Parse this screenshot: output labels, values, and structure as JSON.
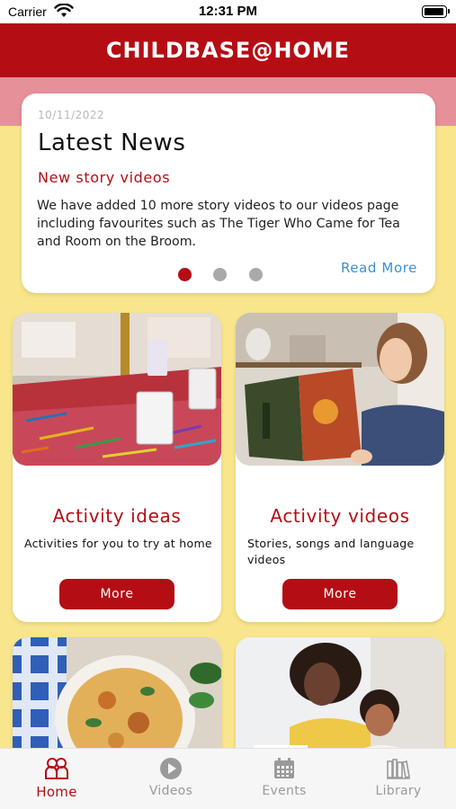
{
  "status_bar": {
    "carrier": "Carrier",
    "time": "12:31 PM"
  },
  "header": {
    "title": "CHILDBASE@HOME"
  },
  "news": {
    "date": "10/11/2022",
    "title": "Latest News",
    "subtitle": "New story videos",
    "body": "We have added 10 more story videos to our videos page including favourites such as The Tiger Who Came for Tea and Room on the Broom.",
    "read_more": "Read More",
    "carousel": {
      "pages": 3,
      "active": 1
    }
  },
  "tiles": [
    {
      "title": "Activity ideas",
      "description": "Activities for you to try at home",
      "button": "More"
    },
    {
      "title": "Activity videos",
      "description": "Stories, songs and language videos",
      "button": "More"
    }
  ],
  "tab_bar": {
    "items": [
      {
        "label": "Home",
        "icon": "people-icon",
        "active": true
      },
      {
        "label": "Videos",
        "icon": "play-circle-icon",
        "active": false
      },
      {
        "label": "Events",
        "icon": "calendar-icon",
        "active": false
      },
      {
        "label": "Library",
        "icon": "books-icon",
        "active": false
      }
    ]
  },
  "colors": {
    "brand_red": "#b50d14",
    "background_yellow": "#f9e68c",
    "band_pink": "#e6909a",
    "link_blue": "#3b8fdc"
  }
}
